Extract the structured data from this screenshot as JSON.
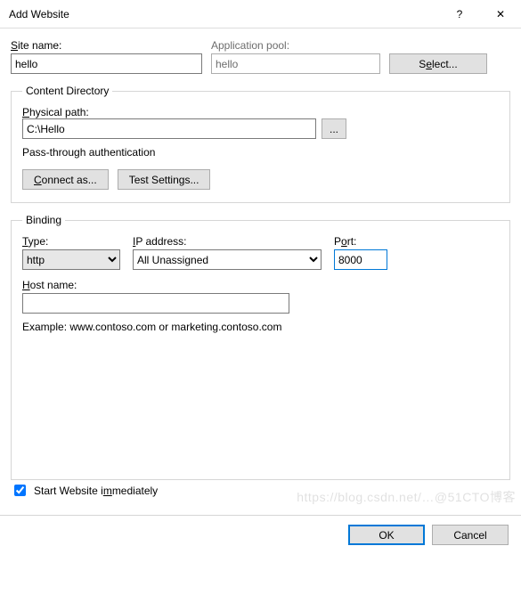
{
  "titlebar": {
    "title": "Add Website",
    "help": "?",
    "close": "✕"
  },
  "siteName": {
    "label_pre": "",
    "label_u": "S",
    "label_post": "ite name:",
    "value": "hello"
  },
  "appPool": {
    "label": "Application pool:",
    "value": "hello",
    "selectBtn_pre": "S",
    "selectBtn_u": "e",
    "selectBtn_post": "lect..."
  },
  "contentDir": {
    "legend": "Content Directory",
    "physPath_label_u": "P",
    "physPath_label_post": "hysical path:",
    "physPath_value": "C:\\Hello",
    "browse": "...",
    "passThrough": "Pass-through authentication",
    "connectAs_u": "C",
    "connectAs_post": "onnect as...",
    "testSettings_pre": "Test Settin",
    "testSettings_u": "g",
    "testSettings_post": "s..."
  },
  "binding": {
    "legend": "Binding",
    "type_label_u": "T",
    "type_label_post": "ype:",
    "type_value": "http",
    "ip_label_u": "I",
    "ip_label_post": "P address:",
    "ip_value": "All Unassigned",
    "port_label_pre": "P",
    "port_label_u": "o",
    "port_label_post": "rt:",
    "port_value": "8000",
    "host_label_u": "H",
    "host_label_post": "ost name:",
    "host_value": "",
    "example": "Example: www.contoso.com or marketing.contoso.com"
  },
  "startImmediately": {
    "label": "Start Website i",
    "label_u": "m",
    "label_post": "mediately",
    "checked": true
  },
  "footer": {
    "ok": "OK",
    "cancel": "Cancel"
  },
  "watermark": "https://blog.csdn.net/…@51CTO博客"
}
